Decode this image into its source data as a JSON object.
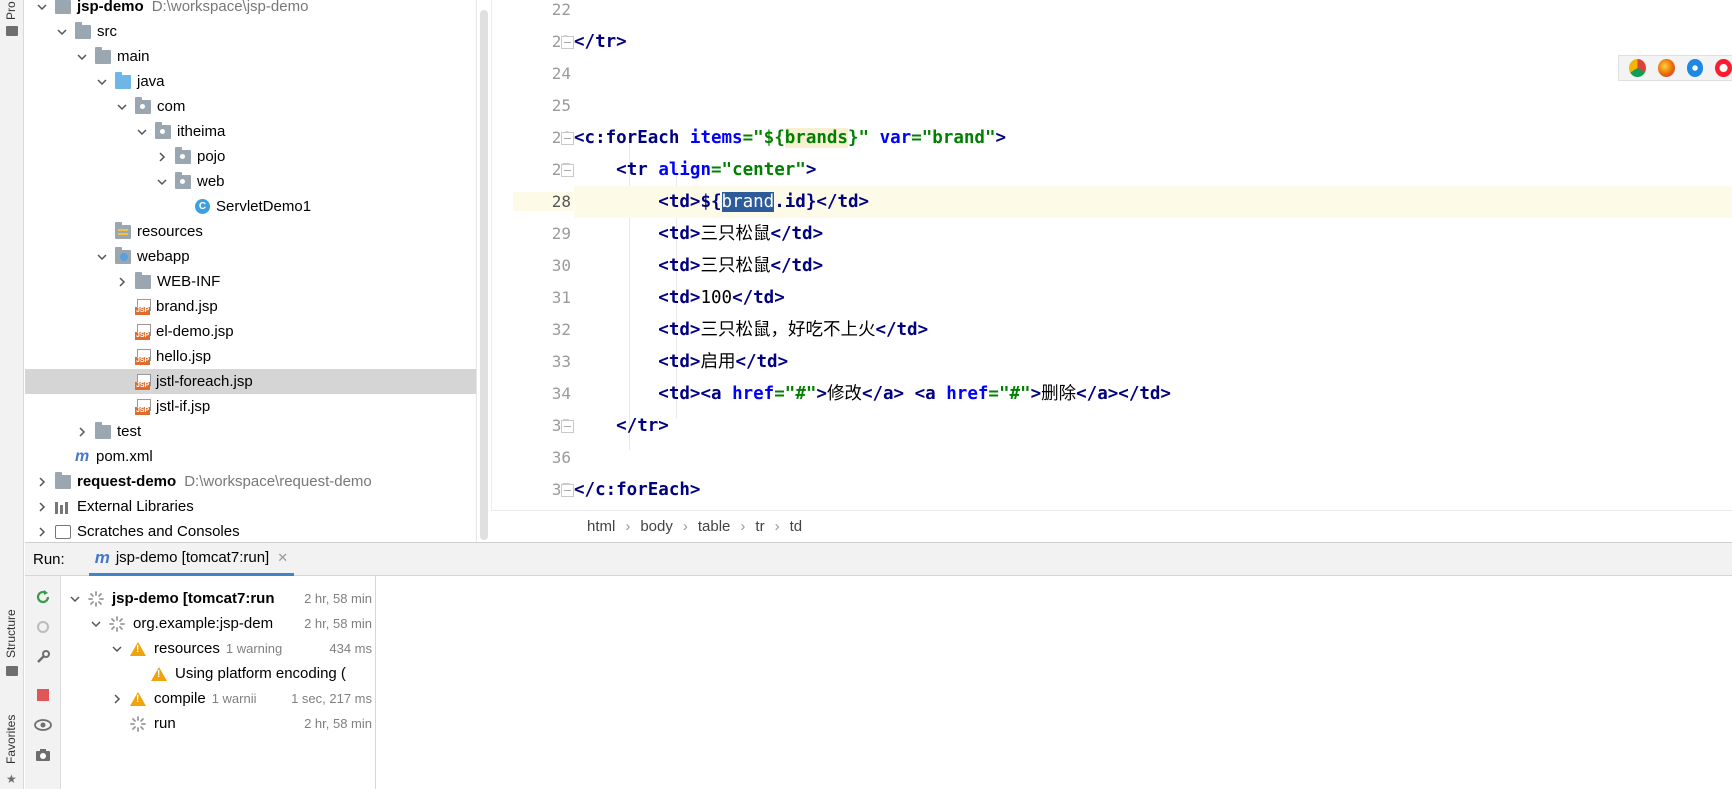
{
  "stripe": {
    "project_tab": "Pro",
    "structure_tab": "Structure",
    "favorites_tab": "Favorites"
  },
  "project_tree": [
    {
      "label": "jsp-demo",
      "path": "D:\\workspace\\jsp-demo",
      "bold": true,
      "expanded": true,
      "icon": "module-folder-icon"
    },
    {
      "label": "src",
      "expanded": true,
      "icon": "folder-icon"
    },
    {
      "label": "main",
      "expanded": true,
      "icon": "folder-icon"
    },
    {
      "label": "java",
      "expanded": true,
      "icon": "source-folder-icon"
    },
    {
      "label": "com",
      "expanded": true,
      "icon": "package-icon"
    },
    {
      "label": "itheima",
      "expanded": true,
      "icon": "package-icon"
    },
    {
      "label": "pojo",
      "expanded": false,
      "icon": "package-icon"
    },
    {
      "label": "web",
      "expanded": true,
      "icon": "package-icon"
    },
    {
      "label": "ServletDemo1",
      "icon": "java-class-icon"
    },
    {
      "label": "resources",
      "icon": "resources-folder-icon"
    },
    {
      "label": "webapp",
      "expanded": true,
      "icon": "web-folder-icon"
    },
    {
      "label": "WEB-INF",
      "expanded": false,
      "icon": "folder-icon"
    },
    {
      "label": "brand.jsp",
      "icon": "jsp-file-icon"
    },
    {
      "label": "el-demo.jsp",
      "icon": "jsp-file-icon"
    },
    {
      "label": "hello.jsp",
      "icon": "jsp-file-icon"
    },
    {
      "label": "jstl-foreach.jsp",
      "icon": "jsp-file-icon",
      "selected": true
    },
    {
      "label": "jstl-if.jsp",
      "icon": "jsp-file-icon"
    },
    {
      "label": "test",
      "expanded": false,
      "icon": "folder-icon"
    },
    {
      "label": "pom.xml",
      "icon": "maven-icon"
    },
    {
      "label": "request-demo",
      "path": "D:\\workspace\\request-demo",
      "bold": true,
      "expanded": false,
      "icon": "module-folder-icon"
    },
    {
      "label": "External Libraries",
      "expanded": false,
      "icon": "libraries-icon"
    },
    {
      "label": "Scratches and Consoles",
      "expanded": false,
      "icon": "scratches-icon"
    }
  ],
  "editor": {
    "line_numbers": [
      "22",
      "23",
      "24",
      "25",
      "26",
      "27",
      "28",
      "29",
      "30",
      "31",
      "32",
      "33",
      "34",
      "35",
      "36",
      "37"
    ],
    "current_line": "28",
    "code": {
      "l23": {
        "close_tr": "</tr>"
      },
      "l26": {
        "open": "<c:forEach",
        "items_attr": "items",
        "eq1": "=",
        "items_q1": "\"${",
        "items_el": "brands",
        "items_q2": "}\"",
        "var_attr": "var",
        "eq2": "=",
        "var_val": "\"brand\"",
        "close": ">"
      },
      "l27": {
        "open": "<tr",
        "attr": "align",
        "eq": "=",
        "val": "\"center\"",
        "close": ">"
      },
      "l28": {
        "open_td": "<td>",
        "el_open": "${",
        "el_sel": "brand",
        "el_rest": ".id",
        "el_close": "}",
        "close_td": "</td>"
      },
      "l29": {
        "open_td": "<td>",
        "text": "三只松鼠",
        "close_td": "</td>"
      },
      "l30": {
        "open_td": "<td>",
        "text": "三只松鼠",
        "close_td": "</td>"
      },
      "l31": {
        "open_td": "<td>",
        "text": "100",
        "close_td": "</td>"
      },
      "l32": {
        "open_td": "<td>",
        "text": "三只松鼠，好吃不上火",
        "close_td": "</td>"
      },
      "l33": {
        "open_td": "<td>",
        "text": "启用",
        "close_td": "</td>"
      },
      "l34": {
        "open_td": "<td>",
        "a1_open": "<a",
        "href_attr": "href",
        "eq1": "=",
        "href_val1": "\"#\"",
        "gt1": ">",
        "edit_text": "修改",
        "a1_close": "</a>",
        "a2_open": "<a",
        "href_attr2": "href",
        "eq2": "=",
        "href_val2": "\"#\"",
        "gt2": ">",
        "delete_text": "删除",
        "a2_close": "</a>",
        "close_td": "</td>"
      },
      "l35": {
        "close_tr": "</tr>"
      },
      "l37": {
        "close_foreach": "</c:forEach>"
      }
    }
  },
  "browsers": [
    "chrome-icon",
    "firefox-icon",
    "safari-icon",
    "opera-icon"
  ],
  "breadcrumb": [
    "html",
    "body",
    "table",
    "tr",
    "td"
  ],
  "run": {
    "label": "Run:",
    "tab_label": "jsp-demo [tomcat7:run]",
    "tab_icon": "maven-icon",
    "tree": [
      {
        "name": "jsp-demo [tomcat7:run",
        "meta": "",
        "time": "2 hr, 58 min",
        "status": "running",
        "bold": true,
        "expanded": true
      },
      {
        "name": "org.example:jsp-dem",
        "meta": "",
        "time": "2 hr, 58 min",
        "status": "running",
        "expanded": true
      },
      {
        "name": "resources",
        "meta": "1 warning",
        "time": "434 ms",
        "status": "warning",
        "expanded": true
      },
      {
        "name": "Using platform encoding (",
        "meta": "",
        "time": "",
        "status": "warning"
      },
      {
        "name": "compile",
        "meta": "1 warnii",
        "time": "1 sec, 217 ms",
        "status": "warning",
        "expanded": false
      },
      {
        "name": "run",
        "meta": "",
        "time": "2 hr, 58 min",
        "status": "running"
      }
    ]
  },
  "colors": {
    "tag": "#000080",
    "attribute": "#0000ff",
    "string": "#008000",
    "selection": "#2e5b9a",
    "current_line": "#fdfbe8",
    "warning": "#f0a30a",
    "accent": "#4083c9"
  }
}
